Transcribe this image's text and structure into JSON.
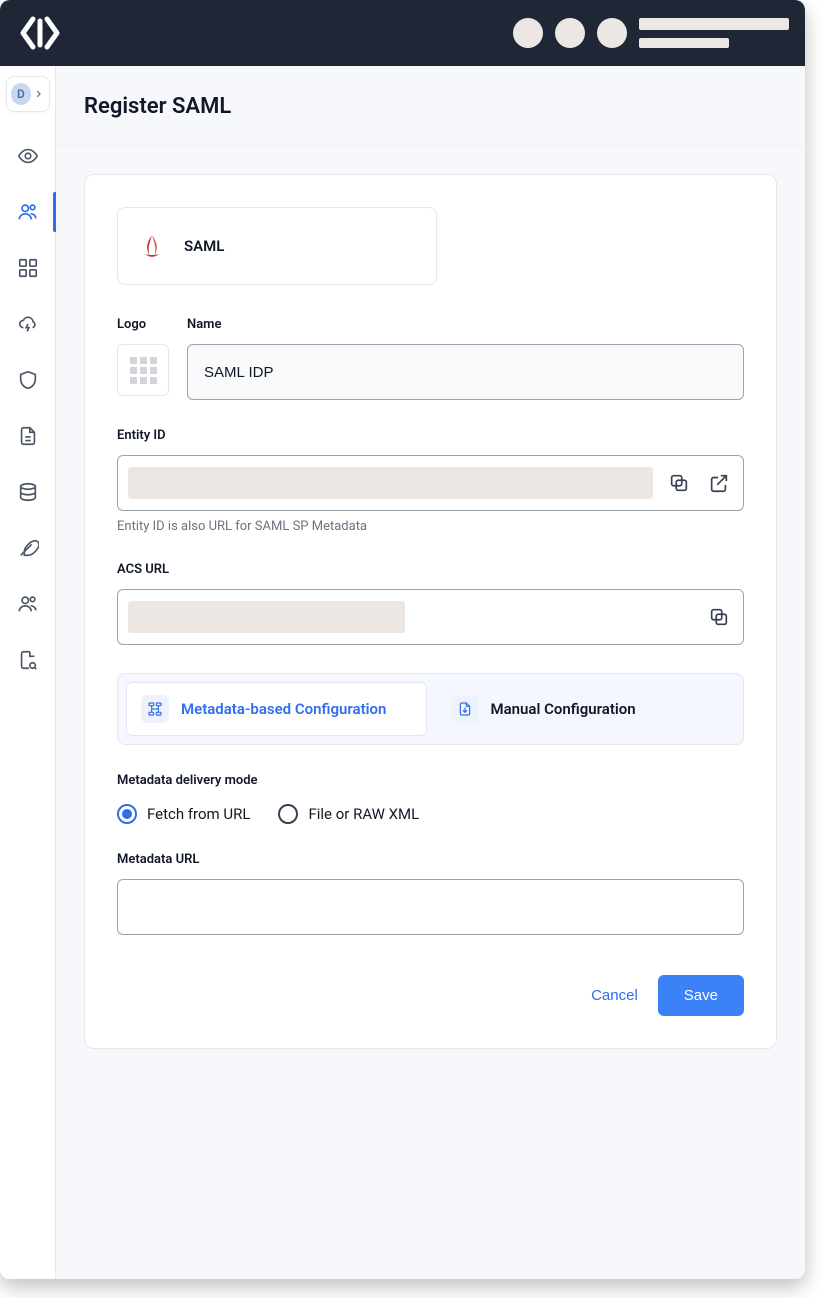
{
  "org_badge": "D",
  "page": {
    "title": "Register SAML"
  },
  "idp": {
    "name": "SAML"
  },
  "form": {
    "logo_label": "Logo",
    "name_label": "Name",
    "name_value": "SAML IDP",
    "entity_id_label": "Entity ID",
    "entity_id_helper": "Entity ID is also URL for SAML SP Metadata",
    "acs_url_label": "ACS URL",
    "config_tabs": {
      "metadata": "Metadata-based Configuration",
      "manual": "Manual Configuration"
    },
    "delivery_mode_label": "Metadata delivery mode",
    "delivery_options": {
      "fetch": "Fetch from URL",
      "file": "File or RAW XML"
    },
    "metadata_url_label": "Metadata URL"
  },
  "actions": {
    "cancel": "Cancel",
    "save": "Save"
  }
}
